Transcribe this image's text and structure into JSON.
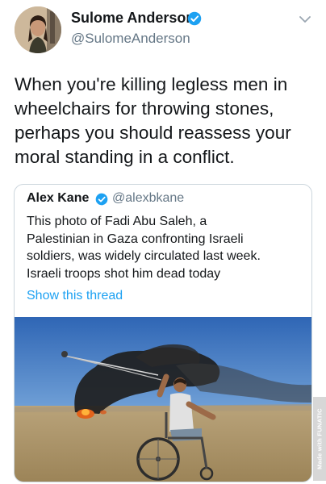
{
  "tweet": {
    "author_name": "Sulome Anderson",
    "author_handle": "@SulomeAnderson",
    "text_lines": [
      "When you're killing legless men in",
      "wheelchairs for throwing stones,",
      "perhaps you should reassess your",
      "moral standing in a conflict."
    ]
  },
  "quoted_tweet": {
    "author_name": "Alex Kane",
    "author_handle": "@alexbkane",
    "text_lines": [
      "This photo of Fadi Abu Saleh, a",
      "Palestinian in Gaza confronting Israeli",
      "soldiers, was widely circulated last week.",
      "Israeli troops shot him dead today"
    ],
    "show_thread_label": "Show this thread"
  },
  "watermark": {
    "text": "Made with FUNATIC"
  },
  "icons": {
    "verified": "verified-badge-icon",
    "menu": "chevron-down-icon"
  },
  "colors": {
    "text": "#14171a",
    "secondary": "#657786",
    "link": "#1da1f2",
    "verified": "#1da1f2",
    "border": "#ccd6dd"
  }
}
